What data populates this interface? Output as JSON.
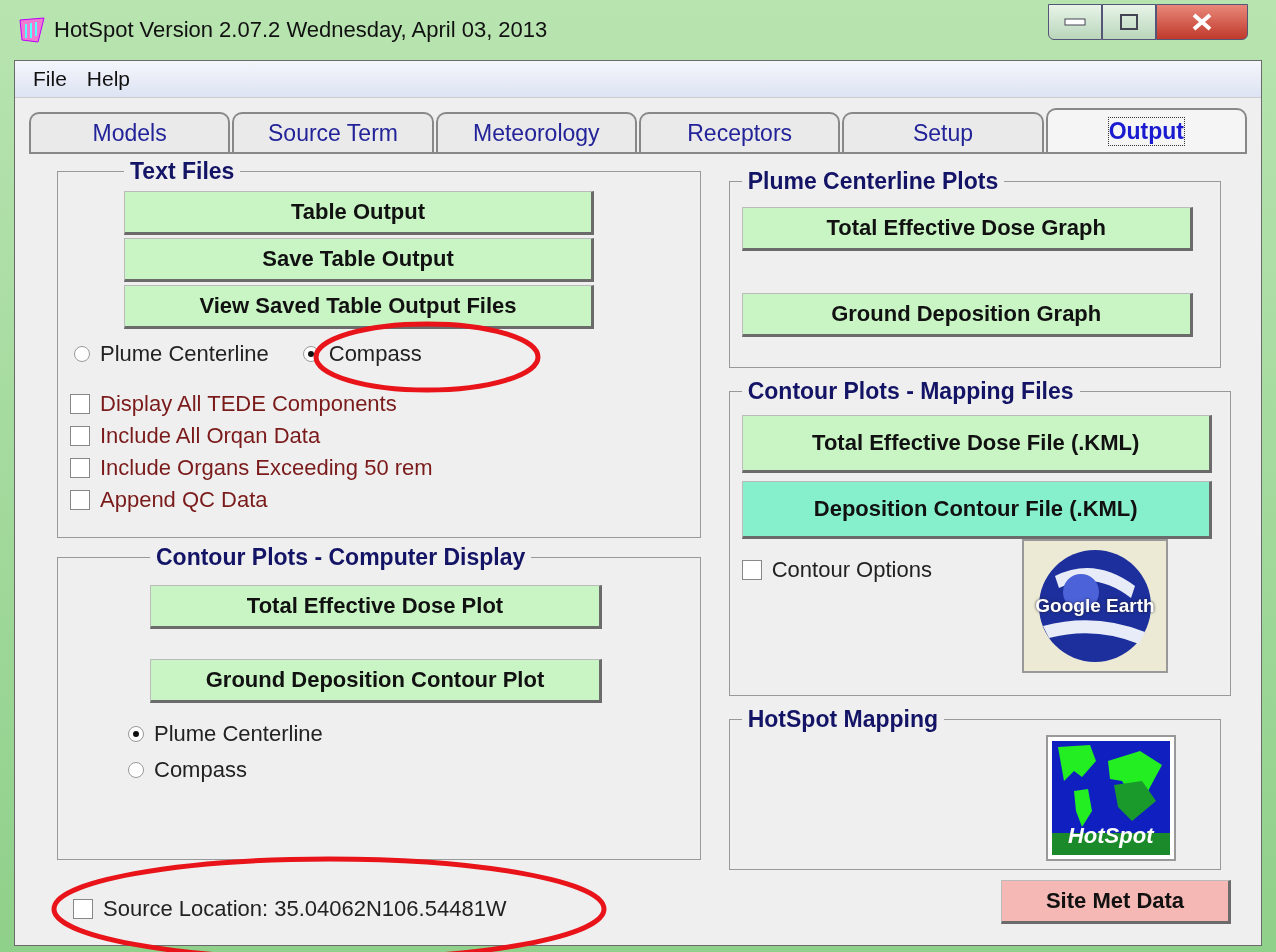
{
  "window": {
    "title": "HotSpot Version 2.07.2  Wednesday, April 03, 2013"
  },
  "menu": [
    "File",
    "Help"
  ],
  "tabs": [
    {
      "label": "Models",
      "selected": false
    },
    {
      "label": "Source Term",
      "selected": false
    },
    {
      "label": "Meteorology",
      "selected": false
    },
    {
      "label": "Receptors",
      "selected": false
    },
    {
      "label": "Setup",
      "selected": false
    },
    {
      "label": "Output",
      "selected": true
    }
  ],
  "text_files": {
    "title": "Text Files",
    "buttons": [
      "Table Output",
      "Save Table Output",
      "View Saved Table Output Files"
    ],
    "radios": [
      {
        "label": "Plume Centerline",
        "selected": false
      },
      {
        "label": "Compass",
        "selected": true
      }
    ],
    "checkboxes": [
      {
        "label": "Display All TEDE Components",
        "checked": false
      },
      {
        "label": "Include All Orqan Data",
        "checked": false
      },
      {
        "label": "Include Organs Exceeding 50 rem",
        "checked": false
      },
      {
        "label": "Append QC Data",
        "checked": false
      }
    ]
  },
  "contour_display": {
    "title": "Contour Plots - Computer Display",
    "buttons": [
      "Total Effective Dose Plot",
      "Ground Deposition Contour Plot"
    ],
    "radios": [
      {
        "label": "Plume Centerline",
        "selected": true
      },
      {
        "label": "Compass",
        "selected": false
      }
    ]
  },
  "source_location": {
    "label": "Source Location: 35.04062N106.54481W",
    "checked": false
  },
  "plume_plots": {
    "title": "Plume Centerline Plots",
    "buttons": [
      "Total Effective Dose Graph",
      "Ground Deposition Graph"
    ]
  },
  "contour_mapping": {
    "title": "Contour Plots - Mapping Files",
    "buttons": [
      {
        "label": "Total Effective Dose File (.KML)",
        "focused": false
      },
      {
        "label": "Deposition Contour File (.KML)",
        "focused": true
      }
    ],
    "checkbox": {
      "label": "Contour Options",
      "checked": false
    },
    "logo_text": "Google Earth"
  },
  "hotspot_mapping": {
    "title": "HotSpot Mapping",
    "logo_text": "HotSpot"
  },
  "site_met_button": "Site Met Data"
}
